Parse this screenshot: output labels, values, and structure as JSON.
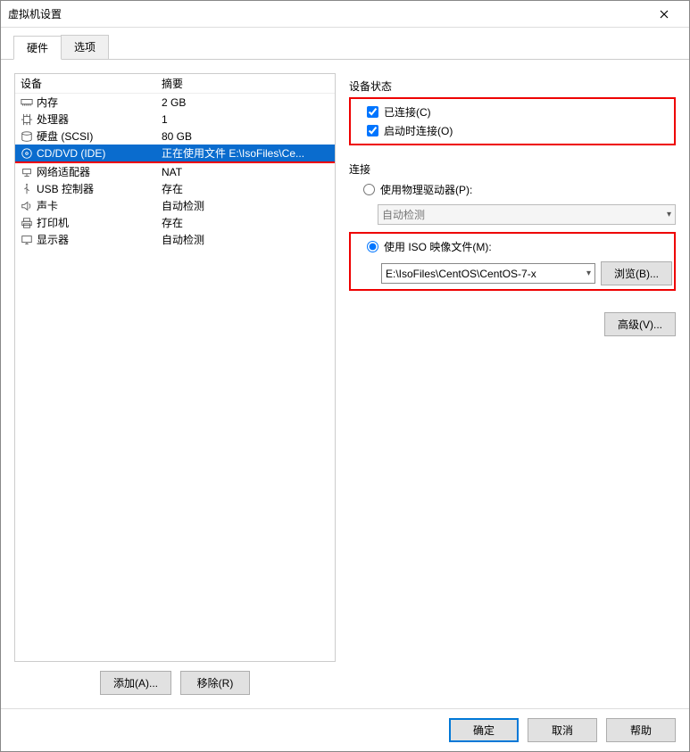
{
  "window": {
    "title": "虚拟机设置"
  },
  "tabs": {
    "hardware": "硬件",
    "options": "选项"
  },
  "device_table": {
    "header": {
      "device": "设备",
      "summary": "摘要"
    },
    "rows": [
      {
        "name": "内存",
        "summary": "2 GB",
        "icon": "memory"
      },
      {
        "name": "处理器",
        "summary": "1",
        "icon": "cpu"
      },
      {
        "name": "硬盘 (SCSI)",
        "summary": "80 GB",
        "icon": "disk"
      },
      {
        "name": "CD/DVD (IDE)",
        "summary": "正在使用文件 E:\\IsoFiles\\Ce...",
        "icon": "cd",
        "selected": true
      },
      {
        "name": "网络适配器",
        "summary": "NAT",
        "icon": "net"
      },
      {
        "name": "USB 控制器",
        "summary": "存在",
        "icon": "usb"
      },
      {
        "name": "声卡",
        "summary": "自动检测",
        "icon": "sound"
      },
      {
        "name": "打印机",
        "summary": "存在",
        "icon": "printer"
      },
      {
        "name": "显示器",
        "summary": "自动检测",
        "icon": "display"
      }
    ]
  },
  "left_buttons": {
    "add": "添加(A)...",
    "remove": "移除(R)"
  },
  "right": {
    "device_status_label": "设备状态",
    "connected": "已连接(C)",
    "connect_at_power": "启动时连接(O)",
    "connection_label": "连接",
    "use_physical": "使用物理驱动器(P):",
    "physical_value": "自动检测",
    "use_iso": "使用 ISO 映像文件(M):",
    "iso_value": "E:\\IsoFiles\\CentOS\\CentOS-7-x",
    "browse": "浏览(B)...",
    "advanced": "高级(V)..."
  },
  "footer": {
    "ok": "确定",
    "cancel": "取消",
    "help": "帮助"
  }
}
